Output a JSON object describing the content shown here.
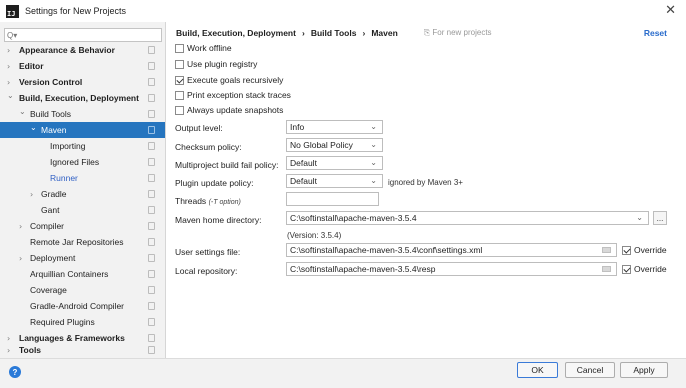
{
  "window": {
    "title": "Settings for New Projects",
    "icon": "intellij-icon",
    "app_icon_text": "IJ",
    "close_symbol": "✕"
  },
  "search": {
    "placeholder": "Q▾"
  },
  "sidebar": {
    "items": [
      {
        "label": "Appearance & Behavior",
        "arrow": "›",
        "bold": true
      },
      {
        "label": "Editor",
        "arrow": "›",
        "bold": true
      },
      {
        "label": "Version Control",
        "arrow": "›",
        "bold": true
      },
      {
        "label": "Build, Execution, Deployment",
        "arrow": "⌄",
        "bold": true
      },
      {
        "label": "Build Tools",
        "arrow": "⌄"
      },
      {
        "label": "Maven",
        "arrow": "⌄",
        "selected": true
      },
      {
        "label": "Importing"
      },
      {
        "label": "Ignored Files"
      },
      {
        "label": "Runner"
      },
      {
        "label": "Gradle",
        "arrow": "›"
      },
      {
        "label": "Gant"
      },
      {
        "label": "Compiler",
        "arrow": "›"
      },
      {
        "label": "Remote Jar Repositories"
      },
      {
        "label": "Deployment",
        "arrow": "›"
      },
      {
        "label": "Arquillian Containers"
      },
      {
        "label": "Coverage"
      },
      {
        "label": "Gradle-Android Compiler"
      },
      {
        "label": "Required Plugins"
      },
      {
        "label": "Languages & Frameworks",
        "arrow": "›",
        "bold": true
      },
      {
        "label": "Tools",
        "arrow": "›",
        "bold": true
      }
    ]
  },
  "breadcrumb": {
    "part1": "Build, Execution, Deployment",
    "sep": "›",
    "part2": "Build Tools",
    "part3": "Maven",
    "for_new": "For new projects",
    "for_new_icon": "⎘"
  },
  "reset_label": "Reset",
  "checkboxes": [
    {
      "label": "Work offline",
      "checked": false
    },
    {
      "label": "Use plugin registry",
      "checked": false
    },
    {
      "label": "Execute goals recursively",
      "checked": true
    },
    {
      "label": "Print exception stack traces",
      "checked": false
    },
    {
      "label": "Always update snapshots",
      "checked": false
    }
  ],
  "fields": {
    "output_level": {
      "label": "Output level:",
      "value": "Info"
    },
    "checksum": {
      "label": "Checksum policy:",
      "value": "No Global Policy"
    },
    "fail_policy": {
      "label": "Multiproject build fail policy:",
      "value": "Default"
    },
    "plugin_update": {
      "label": "Plugin update policy:",
      "value": "Default",
      "note": "ignored by Maven 3+"
    },
    "threads": {
      "label": "Threads",
      "hint": "(-T option)",
      "value": ""
    },
    "maven_home": {
      "label": "Maven home directory:",
      "value": "C:\\softinstall\\apache-maven-3.5.4",
      "version": "(Version: 3.5.4)",
      "browse": "..."
    },
    "user_settings": {
      "label": "User settings file:",
      "value": "C:\\softinstall\\apache-maven-3.5.4\\conf\\settings.xml",
      "override_label": "Override",
      "override_checked": true
    },
    "local_repo": {
      "label": "Local repository:",
      "value": "C:\\softinstall\\apache-maven-3.5.4\\resp",
      "override_label": "Override",
      "override_checked": true
    }
  },
  "chevron": "⌄",
  "buttons": {
    "ok": "OK",
    "cancel": "Cancel",
    "apply": "Apply",
    "help": "?"
  }
}
